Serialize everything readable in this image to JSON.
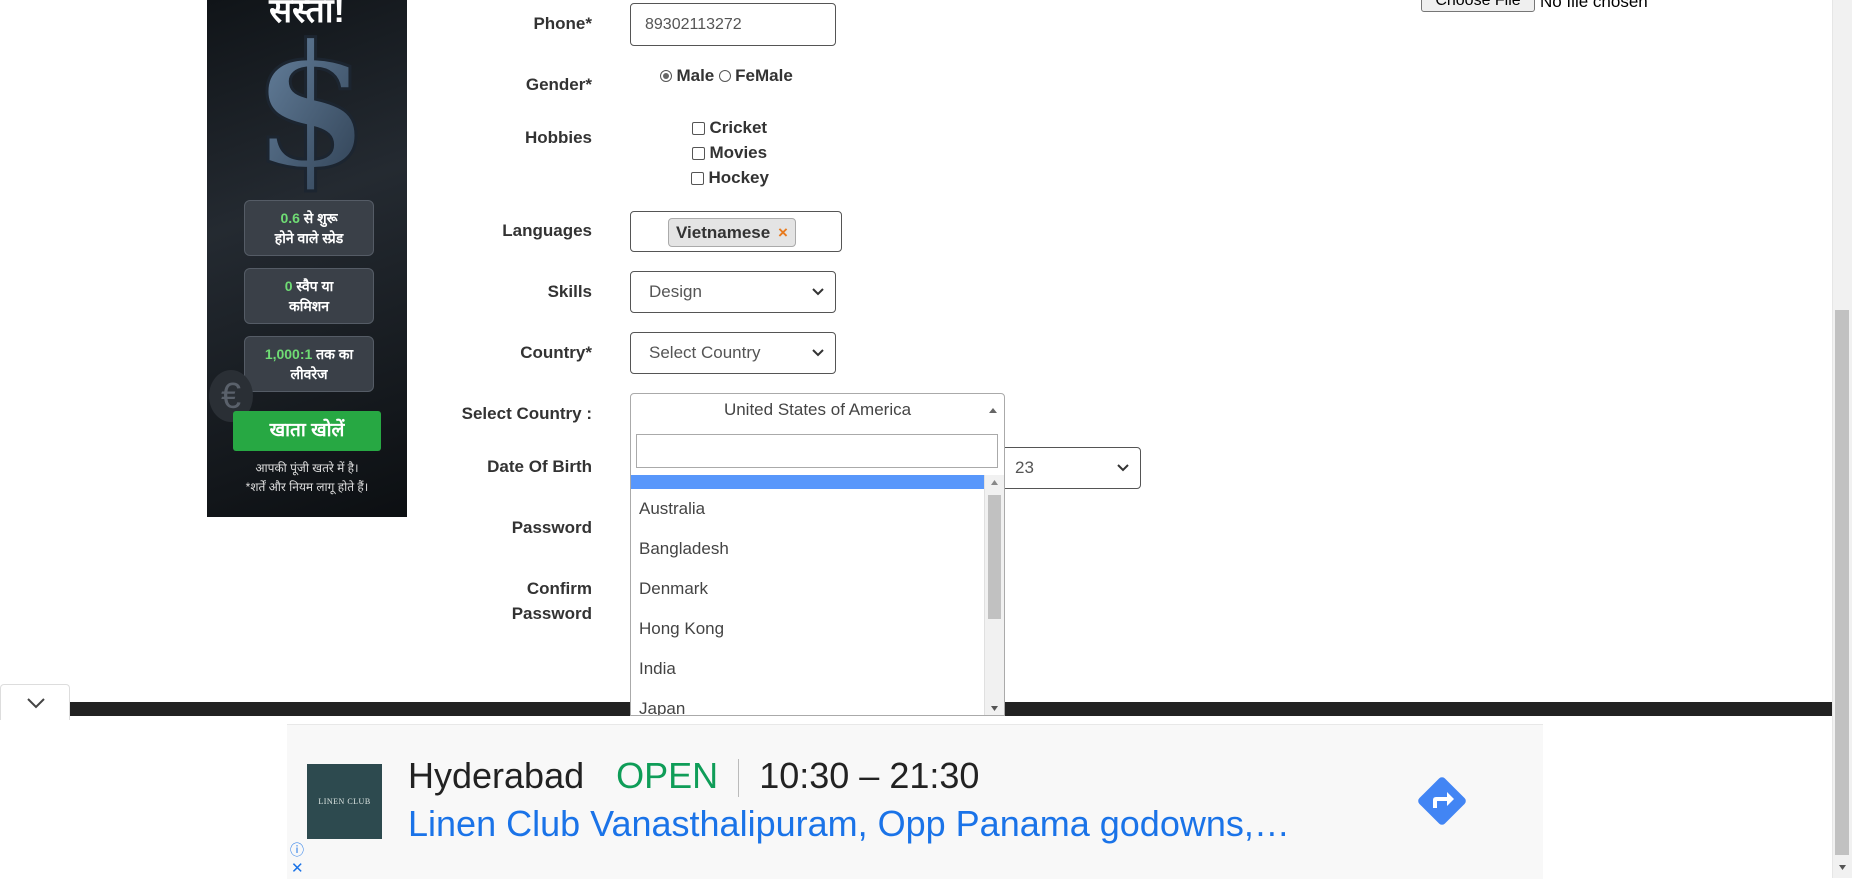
{
  "left_ad": {
    "headline": "सस्ता!",
    "stats": [
      {
        "num": "0.6",
        "line1": " से शुरू",
        "line2": "होने वाले स्प्रेड"
      },
      {
        "num": "0",
        "line1": " स्वैप या",
        "line2": "कमिशन"
      },
      {
        "num": "1,000:1",
        "line1": " तक का",
        "line2": "लीवरेज"
      }
    ],
    "cta": "खाता खोलें",
    "disclaimer1": "आपकी पूंजी खतरे में है।",
    "disclaimer2": "*शर्तें और नियम लागू होते हैं।"
  },
  "file_upload": {
    "button": "Choose File",
    "status": "No file chosen"
  },
  "form": {
    "phone": {
      "label": "Phone*",
      "value": "89302113272"
    },
    "gender": {
      "label": "Gender*",
      "options": [
        "Male",
        "FeMale"
      ],
      "selected": "Male"
    },
    "hobbies": {
      "label": "Hobbies",
      "options": [
        "Cricket",
        "Movies",
        "Hockey"
      ]
    },
    "languages": {
      "label": "Languages",
      "tag": "Vietnamese",
      "remove": "×"
    },
    "skills": {
      "label": "Skills",
      "value": "Design"
    },
    "country": {
      "label": "Country*",
      "value": "Select Country"
    },
    "select_country": {
      "label": "Select Country :",
      "value": "United States of America",
      "options": [
        "Australia",
        "Bangladesh",
        "Denmark",
        "Hong Kong",
        "India",
        "Japan"
      ]
    },
    "dob": {
      "label": "Date Of Birth",
      "day": "23"
    },
    "password": {
      "label": "Password"
    },
    "confirm_password": {
      "label1": "Confirm",
      "label2": "Password"
    }
  },
  "bottom_ad": {
    "logo_text": "LINEN CLUB",
    "city": "Hyderabad",
    "status": "OPEN",
    "hours": "10:30 – 21:30",
    "address": "Linen Club Vanasthalipuram, Opp Panama godowns,…",
    "info": "ⓘ",
    "close": "✕"
  },
  "colors": {
    "open": "#0f9d58",
    "link": "#1a73e8",
    "directions": "#4285f4",
    "highlight": "#5897fb"
  }
}
